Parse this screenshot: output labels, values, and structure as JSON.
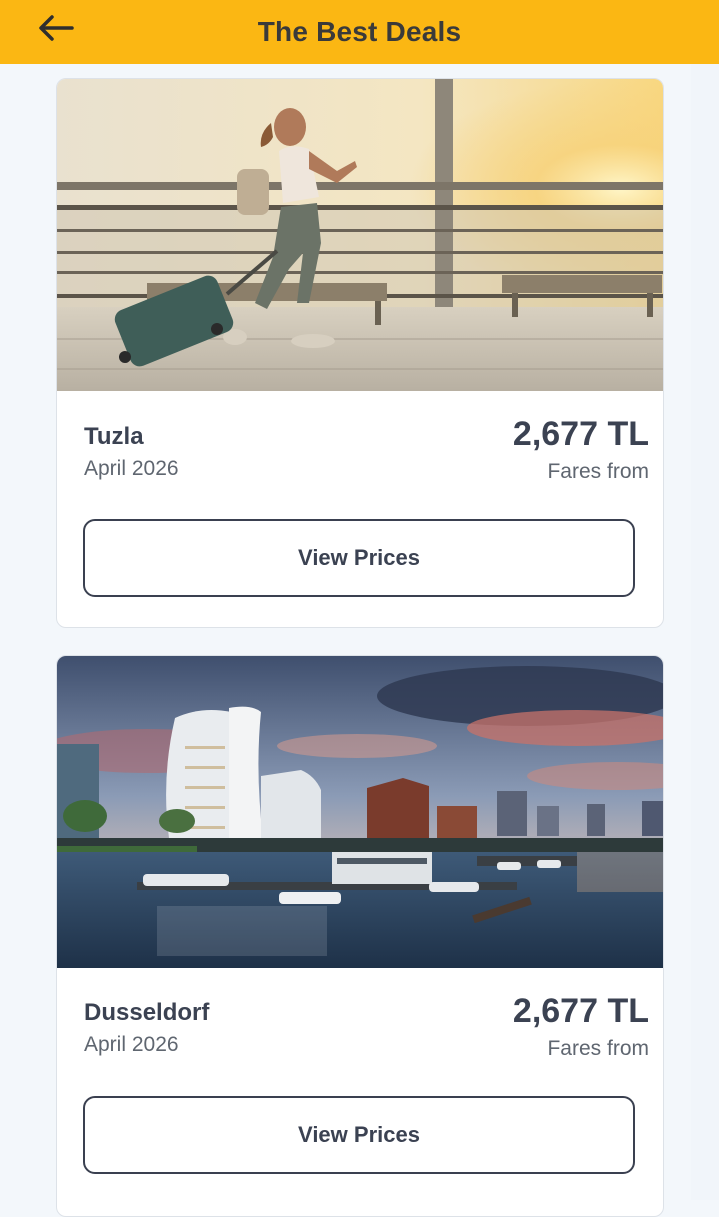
{
  "header": {
    "title": "The Best Deals",
    "back_icon": "arrow-left-icon",
    "background": "#fbb713"
  },
  "deals": [
    {
      "city": "Tuzla",
      "month": "April 2026",
      "price": "2,677 TL",
      "fares_label": "Fares from",
      "button_label": "View Prices",
      "image": "woman-with-suitcase-at-airport"
    },
    {
      "city": "Dusseldorf",
      "month": "April 2026",
      "price": "2,677 TL",
      "fares_label": "Fares from",
      "button_label": "View Prices",
      "image": "dusseldorf-harbor-at-dusk"
    }
  ]
}
